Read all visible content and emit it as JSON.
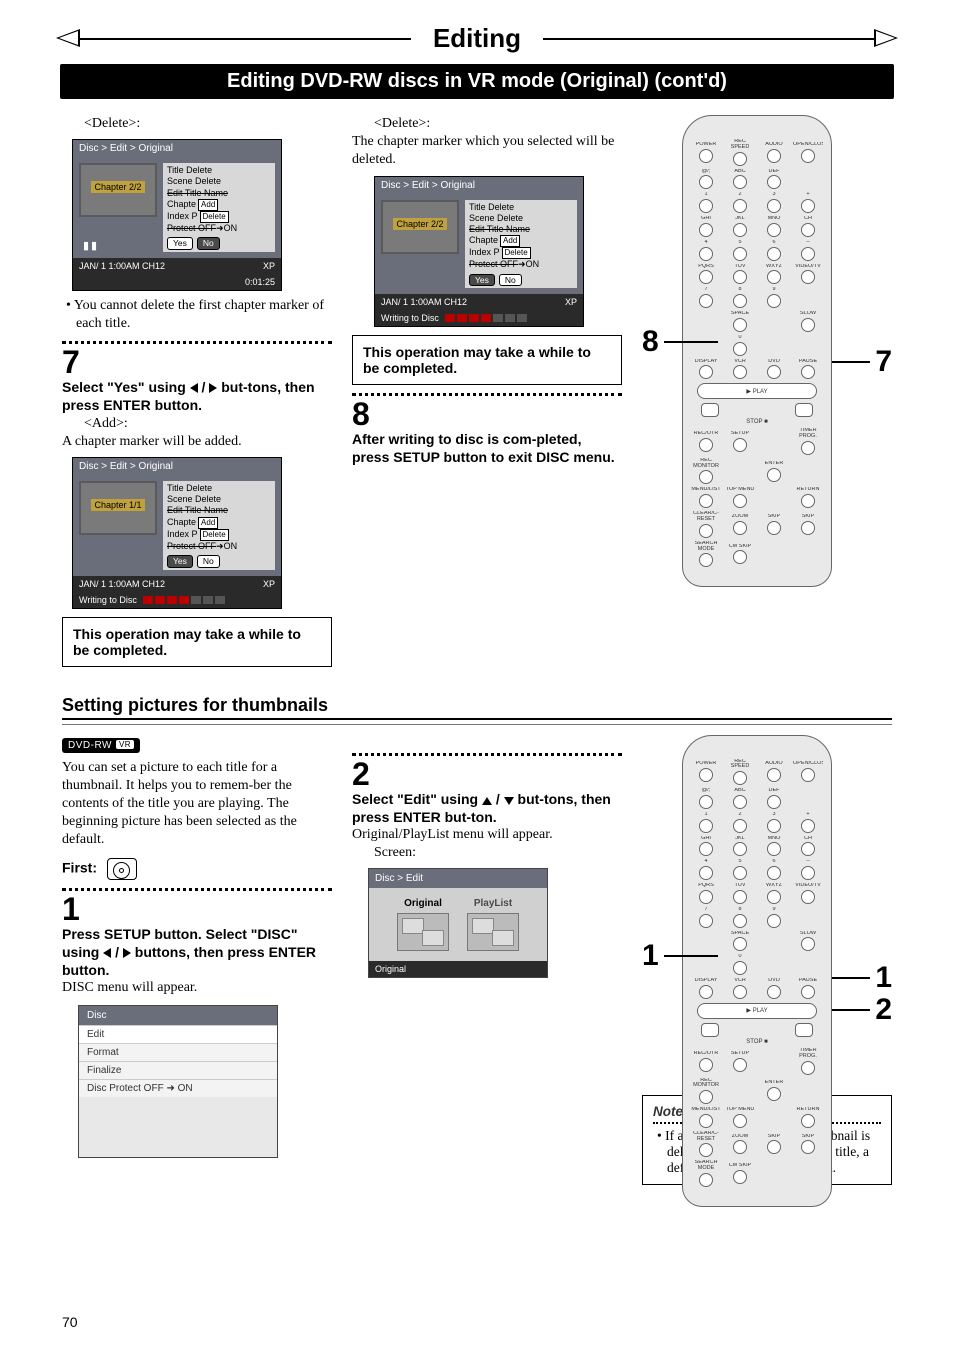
{
  "header": {
    "title": "Editing",
    "subtitle": "Editing DVD-RW discs in VR mode (Original) (cont'd)"
  },
  "col1": {
    "delete_label": "<Delete>:",
    "osd1": {
      "breadcrumb": "Disc > Edit > Original",
      "chapter": "Chapter 2/2",
      "menu": {
        "l1": "Title Delete",
        "l2": "Scene Delete",
        "l3": "Edit Title Name",
        "l4a": "Chapte",
        "l4b": "Add",
        "l5a": "Index P",
        "l5b": "Delete",
        "l6": "Protect OFF",
        "l6b": "ON",
        "yes": "Yes",
        "no": "No"
      },
      "footer_left": "JAN/ 1   1:00AM  CH12",
      "footer_right": "XP",
      "time": "0:01:25"
    },
    "bullet1": "You cannot delete the first chapter marker of each title.",
    "step7_num": "7",
    "step7_line1": "Select \"Yes\" using ",
    "step7_line2": " but-tons, then press ENTER button.",
    "add_label": "<Add>:",
    "add_text": "A chapter marker will be added.",
    "osd2": {
      "breadcrumb": "Disc > Edit > Original",
      "chapter": "Chapter 1/1",
      "footer_left": "JAN/ 1   1:00AM  CH12",
      "footer_right": "XP",
      "writing": "Writing to Disc"
    },
    "callout": "This operation may take a while to be completed."
  },
  "col2": {
    "delete_label": "<Delete>:",
    "delete_text": "The chapter marker which you selected will be deleted.",
    "osd3": {
      "breadcrumb": "Disc > Edit > Original",
      "chapter": "Chapter 2/2",
      "footer_left": "JAN/ 1   1:00AM  CH12",
      "footer_right": "XP",
      "writing": "Writing to Disc"
    },
    "callout": "This operation may take a while to be completed.",
    "step8_num": "8",
    "step8_text": "After writing to disc is com-pleted, press SETUP button to exit DISC menu."
  },
  "section2": {
    "heading": "Setting pictures for thumbnails",
    "badge": "DVD-RW",
    "badge_vr": "VR",
    "intro": "You can set a picture to each title for a thumbnail. It helps you to remem-ber the contents of the title you are playing. The beginning picture has been selected as the default.",
    "first_label": "First:",
    "step1_num": "1",
    "step1_bold": "Press SETUP button. Select \"DISC\" using ",
    "step1_bold2": " buttons, then press ENTER button.",
    "step1_plain": "DISC menu will appear.",
    "disclist": {
      "head": "Disc",
      "rows": [
        "Edit",
        "Format",
        "Finalize",
        "Disc Protect OFF ➜ ON"
      ]
    },
    "step2_num": "2",
    "step2_bold": "Select \"Edit\" using ",
    "step2_bold2": " but-tons, then press ENTER but-ton.",
    "step2_plain": "Original/PlayList menu will appear.",
    "screen_label": "Screen:",
    "editosd": {
      "breadcrumb": "Disc > Edit",
      "tab1": "Original",
      "tab2": "PlayList",
      "footer": "Original"
    }
  },
  "remote": {
    "rows": [
      [
        "POWER",
        "REC SPEED",
        "AUDIO",
        "OPEN/CLOSE"
      ],
      [
        "@/;",
        "ABC",
        "DEF",
        ""
      ],
      [
        "1",
        "2",
        "3",
        "+"
      ],
      [
        "GHI",
        "JKL",
        "MNO",
        "CH"
      ],
      [
        "4",
        "5",
        "6",
        "–"
      ],
      [
        "PQRS",
        "TUV",
        "WXYZ",
        "VIDEO/TV"
      ],
      [
        "7",
        "8",
        "9",
        ""
      ],
      [
        "",
        "SPACE",
        "",
        "SLOW"
      ],
      [
        "",
        "0",
        "",
        ""
      ],
      [
        "DISPLAY",
        "VCR",
        "DVD",
        "PAUSE"
      ],
      [
        "PLAY"
      ],
      [
        "◄◄",
        "",
        "►►"
      ],
      [
        "STOP"
      ],
      [
        "REC/OTR",
        "SETUP",
        "",
        "TIMER PROG."
      ],
      [
        "REC MONITOR",
        "",
        "ENTER",
        ""
      ],
      [
        "MENU/LIST",
        "TOP MENU",
        "",
        "RETURN"
      ],
      [
        "CLEAR/C-RESET",
        "ZOOM",
        "SKIP",
        "SKIP"
      ],
      [
        "SEARCH MODE",
        "CM SKIP",
        "",
        ""
      ]
    ],
    "callouts_top": {
      "left": "8",
      "right": "7"
    },
    "callouts_bot": {
      "left": "1",
      "right1": "1",
      "right2": "2"
    }
  },
  "note": {
    "label": "Note",
    "text": "If a selected picture for a thumbnail is deleted by delet-ing a part of a title, a default picture will be selected."
  },
  "page_number": "70"
}
